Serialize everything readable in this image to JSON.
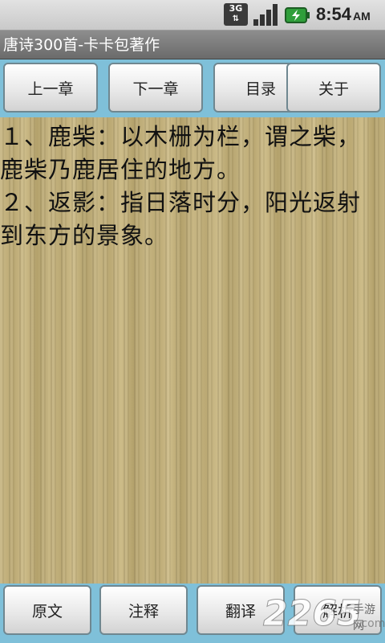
{
  "status_bar": {
    "network_label": "3G",
    "time": "8:54",
    "ampm": "AM",
    "icons": [
      "3g-icon",
      "signal-icon",
      "battery-charging-icon"
    ]
  },
  "title_bar": {
    "title": "唐诗300首-卡卡包著作"
  },
  "toolbar": {
    "prev_chapter": "上一章",
    "next_chapter": "下一章",
    "catalog": "目录",
    "about": "关于"
  },
  "content": {
    "notes": [
      "１、鹿柴：以木栅为栏，谓之柴，鹿柴乃鹿居住的地方。",
      "２、返影：指日落时分，阳光返射到东方的景象。"
    ]
  },
  "bottom_bar": {
    "original": "原文",
    "annotation": "注释",
    "translation": "翻译",
    "analysis": "解析"
  },
  "watermark": {
    "number": "2265",
    "sub": "手游网",
    "domain": ".com"
  },
  "colors": {
    "toolbar_bg": "#7fc0d9",
    "content_bg": "#c0ad78",
    "title_bg": "#7a7a7a"
  }
}
